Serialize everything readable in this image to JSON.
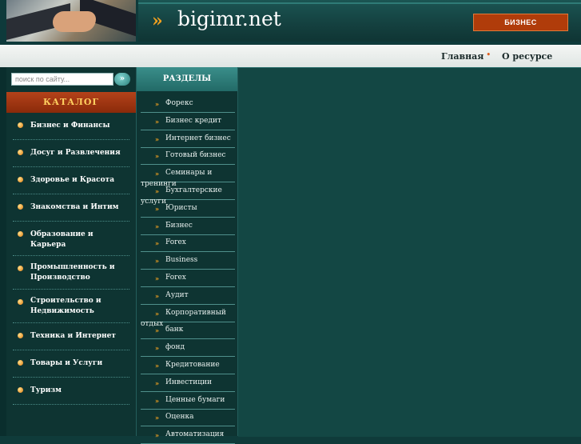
{
  "header": {
    "logo_text": "bigimr.net",
    "logo_arrows": "»",
    "biz_button": "БИЗНЕС"
  },
  "nav": {
    "home": "Главная",
    "separator": "•",
    "about": "О ресурсе"
  },
  "search": {
    "placeholder": "поиск по сайту...",
    "go_icon": "»"
  },
  "catalog": {
    "title": "КАТАЛОГ",
    "items": [
      {
        "label": "Бизнес и Финансы"
      },
      {
        "label": "Досуг и Развлечения"
      },
      {
        "label": "Здоровье и Красота"
      },
      {
        "label": "Знакомства и Интим"
      },
      {
        "label": "Образование и Карьера"
      },
      {
        "label": "Промышленность и",
        "label2": "Производство"
      },
      {
        "label": "Строительство и",
        "label2": "Недвижимость"
      },
      {
        "label": "Техника и Интернет"
      },
      {
        "label": "Товары и Услуги"
      },
      {
        "label": "Туризм"
      }
    ]
  },
  "sections": {
    "title": "РАЗДЕЛЫ",
    "items": [
      {
        "label": "Форекс"
      },
      {
        "label": "Бизнес кредит"
      },
      {
        "label": "Интернет бизнес"
      },
      {
        "label": "Готовый бизнес"
      },
      {
        "label": "Семинары и",
        "label2": "тренинги"
      },
      {
        "label": "Бухгалтерские",
        "label2": "услуги"
      },
      {
        "label": "Юристы"
      },
      {
        "label": "Бизнес"
      },
      {
        "label": "Forex"
      },
      {
        "label": "Business"
      },
      {
        "label": "Forex"
      },
      {
        "label": "Аудит"
      },
      {
        "label": "Корпоративный",
        "label2": "отдых"
      },
      {
        "label": "банк"
      },
      {
        "label": "фонд"
      },
      {
        "label": "Кредитование"
      },
      {
        "label": "Инвестиции"
      },
      {
        "label": "Ценные бумаги"
      },
      {
        "label": "Оценка"
      },
      {
        "label": "Автоматизация"
      }
    ]
  },
  "colors": {
    "background": "#0f3b3a",
    "catalog_head": "#b4421a",
    "accent_orange": "#f0a020",
    "biz_button": "#b03c0a"
  }
}
